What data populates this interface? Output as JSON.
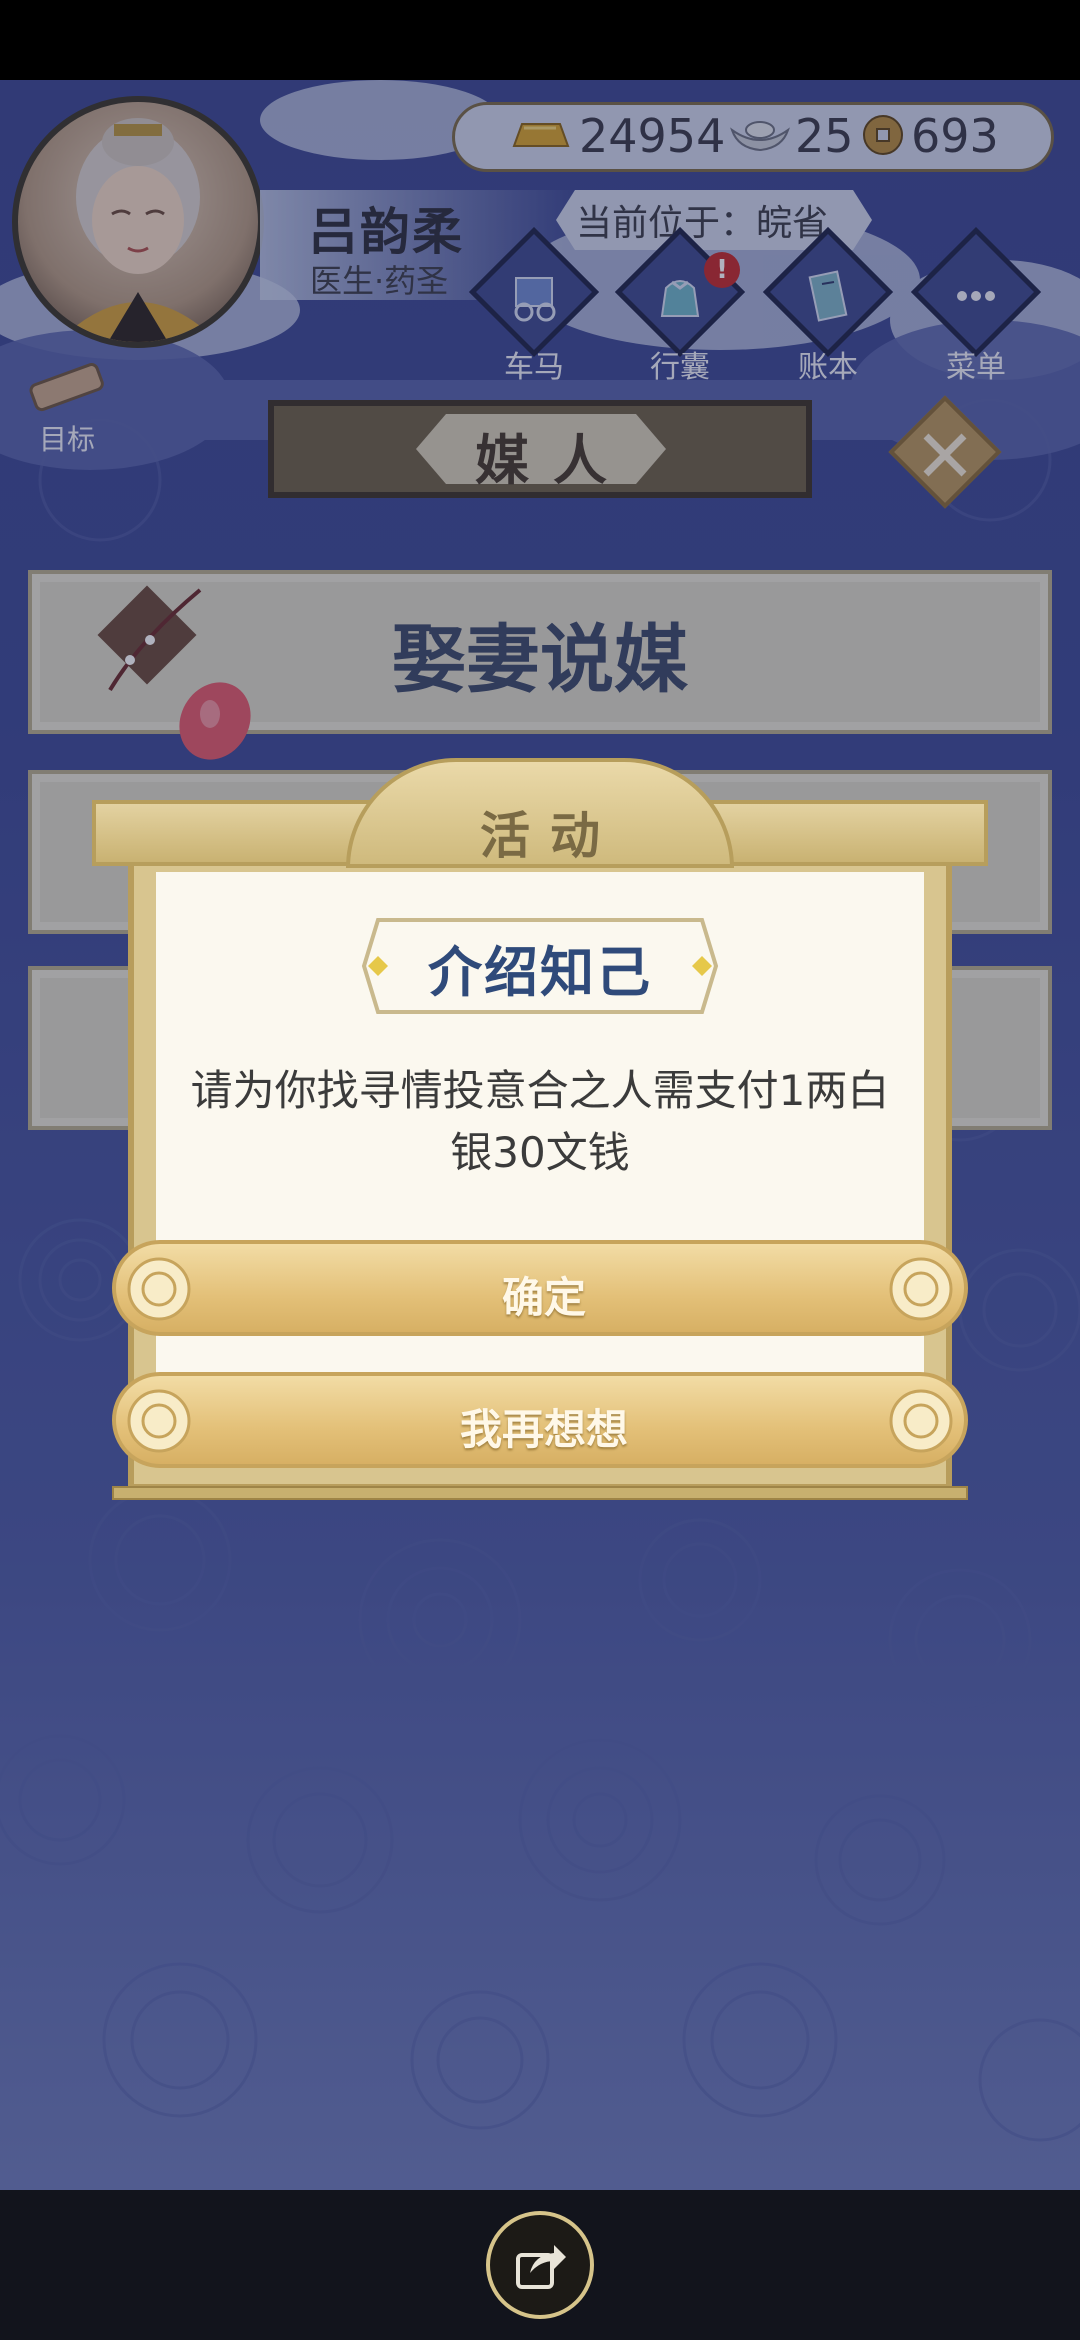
{
  "player": {
    "name": "吕韵柔",
    "title": "医生·药圣"
  },
  "currency": {
    "gold": "24954",
    "silver": "25",
    "coins": "693"
  },
  "location": "当前位于：皖省",
  "menu": {
    "items": [
      {
        "label": "车马",
        "icon": "carriage-icon"
      },
      {
        "label": "行囊",
        "icon": "bag-icon",
        "alert": "!"
      },
      {
        "label": "账本",
        "icon": "ledger-icon"
      },
      {
        "label": "菜单",
        "icon": "more-icon"
      }
    ],
    "goal_label": "目标"
  },
  "page": {
    "title": "媒人"
  },
  "list": {
    "first_item": "娶妻说媒"
  },
  "dialog": {
    "header": "活动",
    "subtitle": "介绍知己",
    "message": "请为你找寻情投意合之人需支付1两白银30文钱",
    "confirm_label": "确定",
    "cancel_label": "我再想想"
  },
  "colors": {
    "background": "#3c4891",
    "gold_button": "#e3c078",
    "subtitle_text": "#2f4a7a",
    "banner": "#6e6146"
  }
}
